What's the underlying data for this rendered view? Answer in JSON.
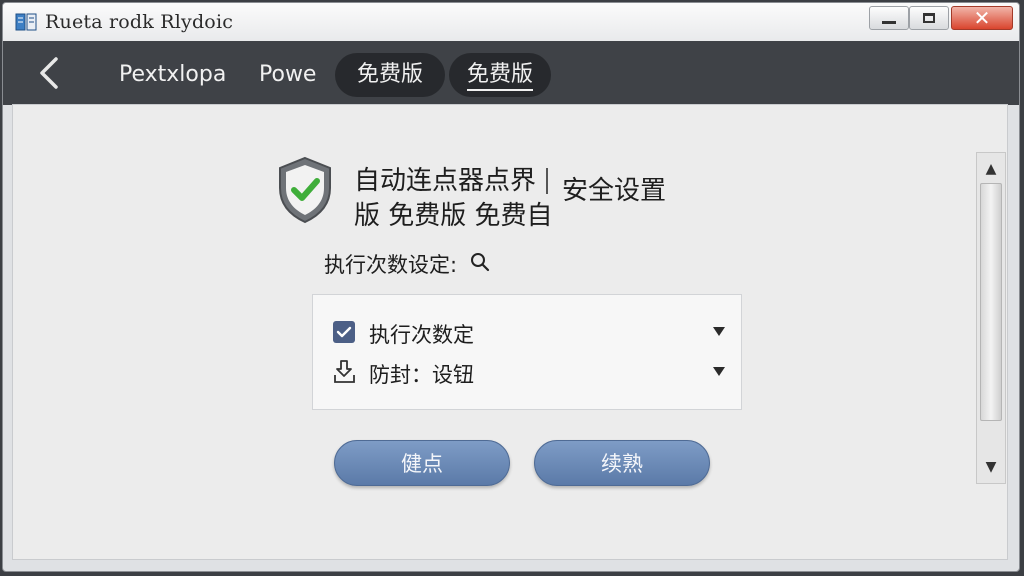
{
  "window": {
    "title": "Rueta rodk Rlydoic",
    "app_icon": "app-icon",
    "controls": {
      "minimize": "minimize-icon",
      "maximize": "maximize-icon",
      "close": "close-icon",
      "close_glyph": "✕"
    }
  },
  "toolbar": {
    "back_icon": "chevron-left-icon",
    "tabs": [
      {
        "label": "Pextxlopa"
      },
      {
        "label": "Powe"
      },
      {
        "label": "免费版"
      },
      {
        "label": "免费版"
      }
    ]
  },
  "main": {
    "heading": {
      "line1": "自动连点器点界",
      "line2": "版 免费版 免费自",
      "right": "安全设置",
      "icon": "shield-check-icon"
    },
    "count_label": "执行次数设定:",
    "count_icon": "search-icon",
    "panel": {
      "rows": [
        {
          "label": "执行次数定",
          "icon": "checkbox-checked-icon",
          "checked": true
        },
        {
          "label": "防封：设钮",
          "icon": "download-icon"
        }
      ]
    },
    "buttons": [
      {
        "label": "健点"
      },
      {
        "label": "续熟"
      }
    ]
  },
  "colors": {
    "toolbar_bg": "#3f4247",
    "button_accent": "#6a89b6",
    "shield_green": "#3fae3a"
  }
}
